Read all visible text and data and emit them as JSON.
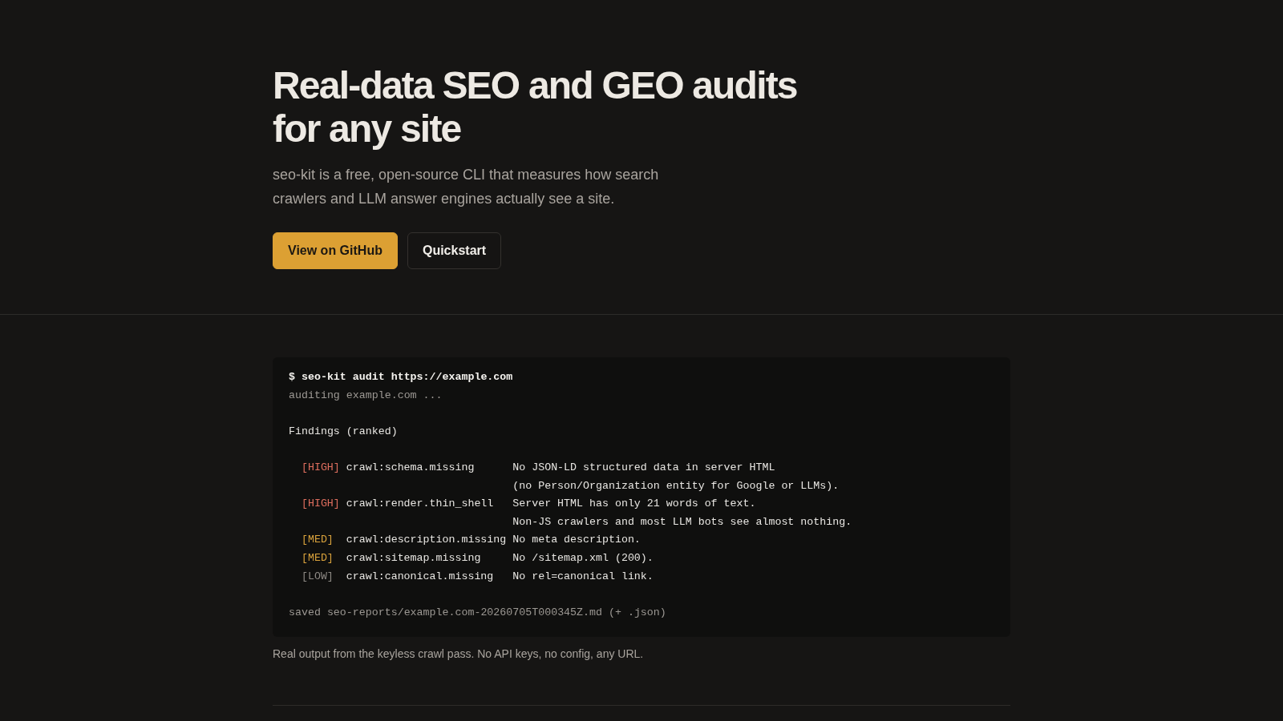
{
  "hero": {
    "title": "Real-data SEO and GEO audits for any site",
    "subtitle": "seo-kit is a free, open-source CLI that measures how search crawlers and LLM answer engines actually see a site.",
    "buttons": [
      {
        "label": "View on GitHub",
        "kind": "primary"
      },
      {
        "label": "Quickstart",
        "kind": "secondary"
      }
    ]
  },
  "terminal": {
    "command": "$ seo-kit audit https://example.com",
    "status": "auditing example.com ...",
    "heading": "Findings (ranked)",
    "findings": [
      {
        "severity": "[HIGH]",
        "color": "#de6e5e",
        "rule": "crawl:schema.missing",
        "message_lines": [
          "No JSON-LD structured data in server HTML",
          "(no Person/Organization entity for Google or LLMs)."
        ]
      },
      {
        "severity": "[HIGH]",
        "color": "#de6e5e",
        "rule": "crawl:render.thin_shell",
        "message_lines": [
          "Server HTML has only 21 words of text.",
          "Non-JS crawlers and most LLM bots see almost nothing."
        ]
      },
      {
        "severity": "[MED]",
        "color": "#d9a23c",
        "rule": "crawl:description.missing",
        "message_lines": [
          "No meta description."
        ]
      },
      {
        "severity": "[MED]",
        "color": "#d9a23c",
        "rule": "crawl:sitemap.missing",
        "message_lines": [
          "No /sitemap.xml (200)."
        ]
      },
      {
        "severity": "[LOW]",
        "color": "#8c8883",
        "rule": "crawl:canonical.missing",
        "message_lines": [
          "No rel=canonical link."
        ]
      }
    ],
    "saved": "saved seo-reports/example.com-20260705T000345Z.md (+ .json)"
  },
  "caption": "Real output from the keyless crawl pass. No API keys, no config, any URL."
}
